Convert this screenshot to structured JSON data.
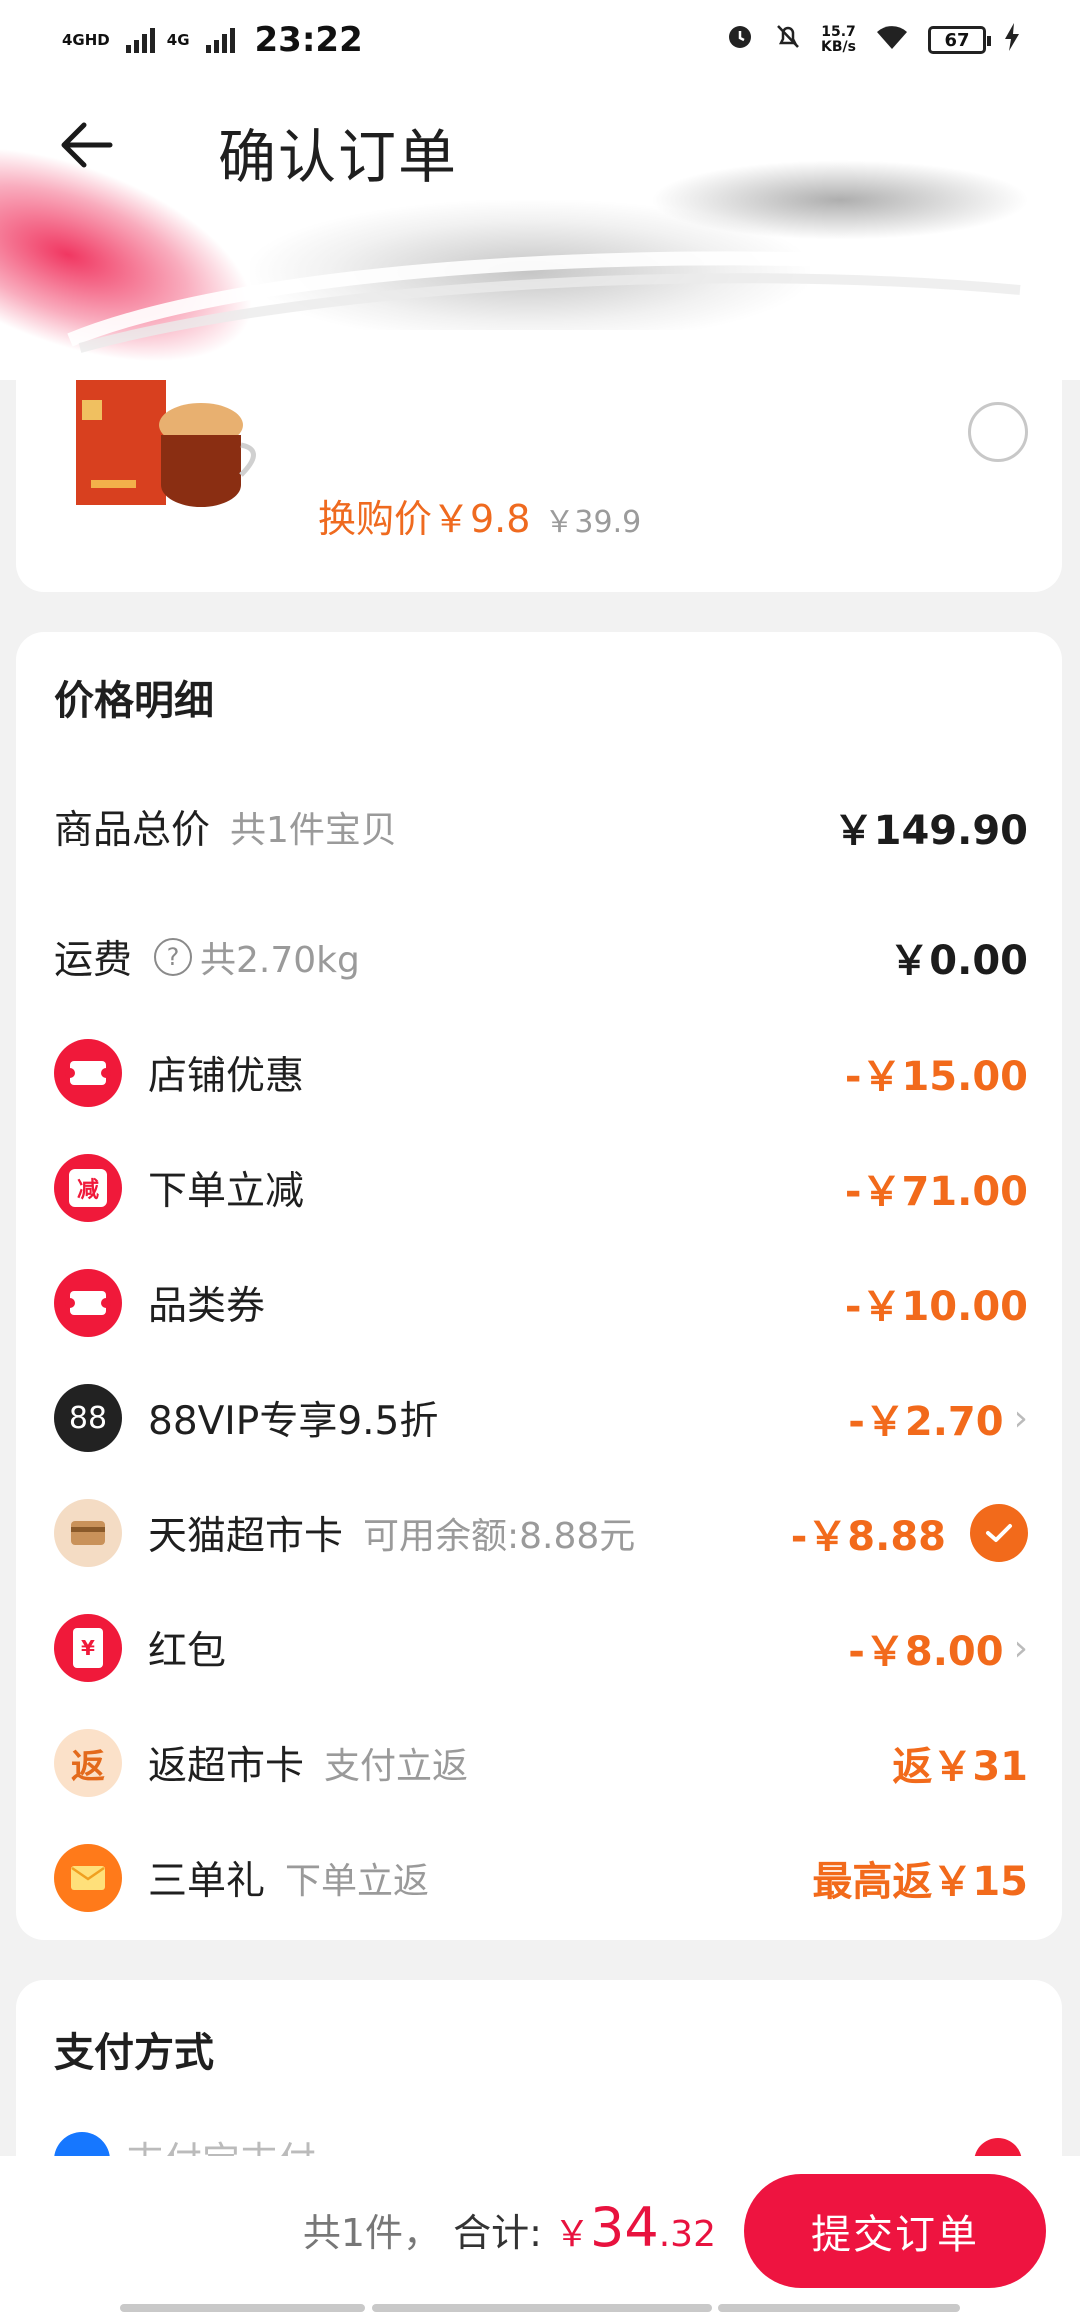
{
  "status_bar": {
    "network1": "4GHD",
    "network2": "4G",
    "time": "23:22",
    "speed_value": "15.7",
    "speed_unit": "KB/s",
    "battery": "67"
  },
  "header": {
    "title": "确认订单"
  },
  "product": {
    "exchange_price": "换购价￥9.8",
    "original_price": "￥39.9"
  },
  "price_detail": {
    "title": "价格明细",
    "items_total": {
      "label": "商品总价",
      "sub": "共1件宝贝",
      "value": "￥149.90"
    },
    "shipping": {
      "label": "运费",
      "sub": "共2.70kg",
      "value": "￥0.00"
    },
    "discounts": [
      {
        "label": "店铺优惠",
        "value": "-￥15.00",
        "icon": "ticket-icon"
      },
      {
        "label": "下单立减",
        "value": "-￥71.00",
        "icon": "reduce-icon",
        "icon_text": "减"
      },
      {
        "label": "品类券",
        "value": "-￥10.00",
        "icon": "ticket-icon"
      },
      {
        "label": "88VIP专享9.5折",
        "value": "-￥2.70",
        "icon": "vip-88-icon",
        "icon_text": "88"
      },
      {
        "label": "天猫超市卡",
        "sub": "可用余额:8.88元",
        "value": "-￥8.88",
        "icon": "card-icon"
      },
      {
        "label": "红包",
        "value": "-￥8.00",
        "icon": "red-packet-icon",
        "icon_text": "¥"
      },
      {
        "label": "返超市卡",
        "sub": "支付立返",
        "value": "返￥31",
        "icon": "rebate-icon",
        "icon_text": "返"
      },
      {
        "label": "三单礼",
        "sub": "下单立返",
        "value": "最高返￥15",
        "icon": "envelope-icon"
      }
    ]
  },
  "payment": {
    "title": "支付方式",
    "method": "支付宝支付"
  },
  "bottom_bar": {
    "count": "共1件，",
    "total_label": "合计:",
    "currency": "￥",
    "amount_int": "34",
    "amount_dec": ".32",
    "submit": "提交订单"
  },
  "colors": {
    "accent_red": "#ee1440",
    "discount_orange": "#f26a1b"
  }
}
